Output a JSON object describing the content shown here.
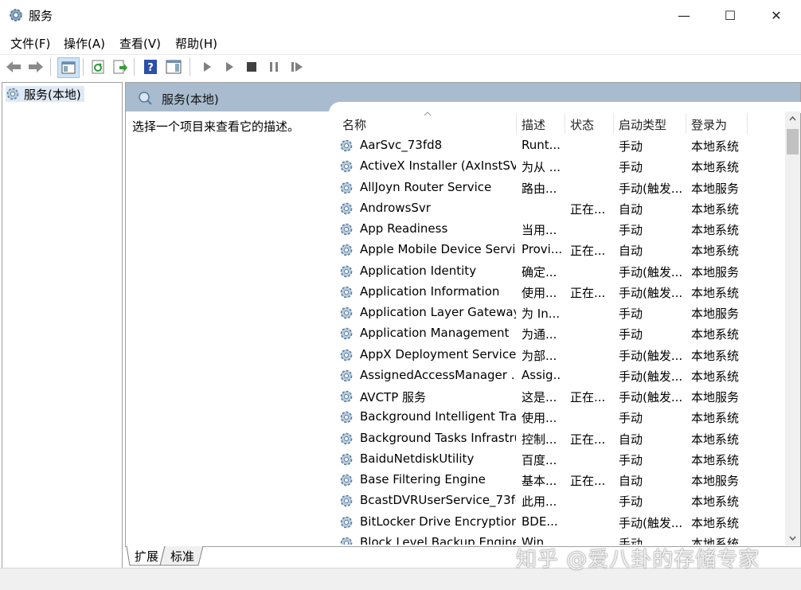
{
  "window": {
    "title": "服务",
    "minimize": "—",
    "maximize": "☐",
    "close": "✕"
  },
  "menu": [
    "文件(F)",
    "操作(A)",
    "查看(V)",
    "帮助(H)"
  ],
  "tree": {
    "root_label": "服务(本地)"
  },
  "pane": {
    "title": "服务(本地)",
    "description": "选择一个项目来查看它的描述。"
  },
  "columns": [
    "名称",
    "描述",
    "状态",
    "启动类型",
    "登录为"
  ],
  "services": [
    {
      "name": "AarSvc_73fd8",
      "desc": "Runt...",
      "status": "",
      "startup": "手动",
      "logon": "本地系统"
    },
    {
      "name": "ActiveX Installer (AxInstSV)",
      "desc": "为从 ...",
      "status": "",
      "startup": "手动",
      "logon": "本地系统"
    },
    {
      "name": "AllJoyn Router Service",
      "desc": "路由...",
      "status": "",
      "startup": "手动(触发...",
      "logon": "本地服务"
    },
    {
      "name": "AndrowsSvr",
      "desc": "",
      "status": "正在...",
      "startup": "自动",
      "logon": "本地系统"
    },
    {
      "name": "App Readiness",
      "desc": "当用...",
      "status": "",
      "startup": "手动",
      "logon": "本地系统"
    },
    {
      "name": "Apple Mobile Device Servi...",
      "desc": "Provi...",
      "status": "正在...",
      "startup": "自动",
      "logon": "本地系统"
    },
    {
      "name": "Application Identity",
      "desc": "确定...",
      "status": "",
      "startup": "手动(触发...",
      "logon": "本地服务"
    },
    {
      "name": "Application Information",
      "desc": "使用...",
      "status": "正在...",
      "startup": "手动(触发...",
      "logon": "本地系统"
    },
    {
      "name": "Application Layer Gateway ...",
      "desc": "为 In...",
      "status": "",
      "startup": "手动",
      "logon": "本地服务"
    },
    {
      "name": "Application Management",
      "desc": "为通...",
      "status": "",
      "startup": "手动",
      "logon": "本地系统"
    },
    {
      "name": "AppX Deployment Service ...",
      "desc": "为部...",
      "status": "",
      "startup": "手动(触发...",
      "logon": "本地系统"
    },
    {
      "name": "AssignedAccessManager ...",
      "desc": "Assig...",
      "status": "",
      "startup": "手动(触发...",
      "logon": "本地系统"
    },
    {
      "name": "AVCTP 服务",
      "desc": "这是...",
      "status": "正在...",
      "startup": "手动(触发...",
      "logon": "本地服务"
    },
    {
      "name": "Background Intelligent Tra...",
      "desc": "使用...",
      "status": "",
      "startup": "手动",
      "logon": "本地系统"
    },
    {
      "name": "Background Tasks Infrastru...",
      "desc": "控制...",
      "status": "正在...",
      "startup": "自动",
      "logon": "本地系统"
    },
    {
      "name": "BaiduNetdiskUtility",
      "desc": "百度...",
      "status": "",
      "startup": "手动",
      "logon": "本地系统"
    },
    {
      "name": "Base Filtering Engine",
      "desc": "基本...",
      "status": "正在...",
      "startup": "自动",
      "logon": "本地服务"
    },
    {
      "name": "BcastDVRUserService_73fd8",
      "desc": "此用...",
      "status": "",
      "startup": "手动",
      "logon": "本地系统"
    },
    {
      "name": "BitLocker Drive Encryption ...",
      "desc": "BDE...",
      "status": "",
      "startup": "手动(触发...",
      "logon": "本地系统"
    },
    {
      "name": "Block Level Backup Engine ...",
      "desc": "Win...",
      "status": "",
      "startup": "手动",
      "logon": "本地系统"
    }
  ],
  "tabs": [
    "扩展",
    "标准"
  ],
  "watermark": "知乎 @爱八卦的存储专家",
  "colors": {
    "header_bg": "#a9bccf",
    "selection_bg": "#dfe9f5",
    "statusbar_bg": "#f0f0f0"
  }
}
